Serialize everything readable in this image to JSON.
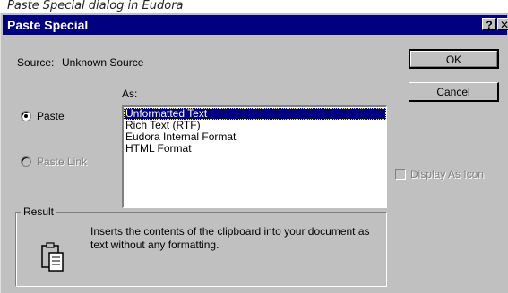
{
  "caption": "Paste Special dialog in Eudora",
  "dialog": {
    "title": "Paste Special",
    "help_glyph": "?",
    "close_glyph": "✕",
    "source_label": "Source:",
    "source_value": "Unknown Source",
    "as_label": "As:",
    "buttons": {
      "ok": "OK",
      "cancel": "Cancel"
    },
    "paste_options": [
      {
        "label": "Paste",
        "selected": true,
        "enabled": true
      },
      {
        "label": "Paste Link",
        "selected": false,
        "enabled": false
      }
    ],
    "formats": [
      {
        "label": "Unformatted Text",
        "selected": true
      },
      {
        "label": "Rich Text (RTF)",
        "selected": false
      },
      {
        "label": "Eudora Internal Format",
        "selected": false
      },
      {
        "label": "HTML Format",
        "selected": false
      }
    ],
    "display_as_icon": {
      "label": "Display As Icon",
      "checked": false,
      "enabled": false
    },
    "result": {
      "legend": "Result",
      "text": "Inserts the contents of the clipboard into your document as text without any formatting.",
      "icon": "clipboard-paste-icon"
    }
  },
  "colors": {
    "titlebar": "#000080",
    "face": "#c0c0c0",
    "selection": "#000080",
    "disabled_text": "#808080"
  }
}
